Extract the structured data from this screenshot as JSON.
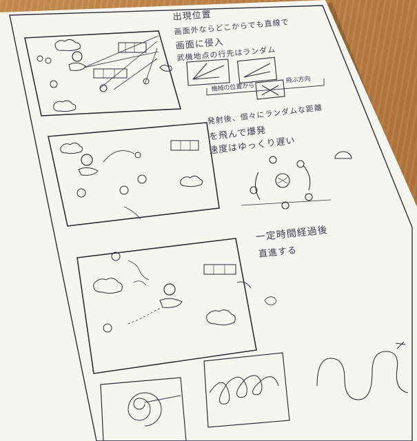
{
  "notes": {
    "panel1_heading": "出現位置",
    "panel1_line1": "画面外ならどこからでも直線で",
    "panel1_line2": "画面に侵入",
    "panel1_line3": "武機地点の行先はランダム",
    "panel1_small_left": "機械の位置から",
    "panel1_small_right": "飛ぶ方向",
    "panel2_line1": "発射後、個々にランダムな距離",
    "panel2_line2": "を飛んで爆発",
    "panel2_line3": "速度はゆっくり遅い",
    "panel3_line1": "一定時間経過後",
    "panel3_line2": "直進する"
  }
}
